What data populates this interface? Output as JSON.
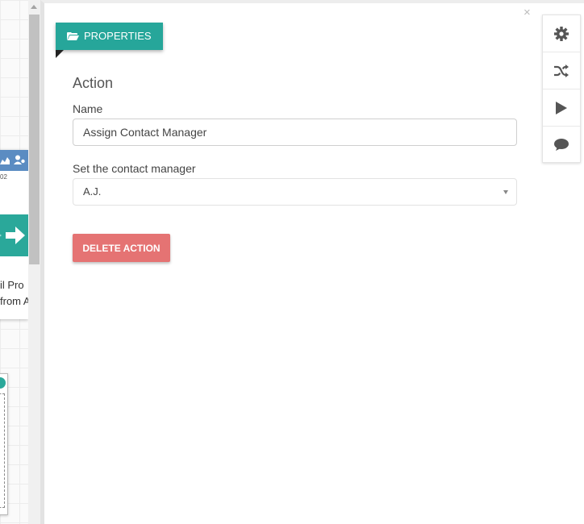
{
  "canvas": {
    "node_line1": "il Pro",
    "node_line2": "from A",
    "node_small": "02"
  },
  "panel": {
    "close": "×",
    "tag_label": "PROPERTIES",
    "section_title": "Action",
    "name_label": "Name",
    "name_value": "Assign Contact Manager",
    "manager_label": "Set the contact manager",
    "manager_value": "A.J.",
    "delete_label": "DELETE ACTION"
  },
  "toolbar": {
    "icons": [
      "gear-icon",
      "shuffle-icon",
      "play-icon",
      "comment-icon"
    ]
  },
  "colors": {
    "accent": "#26a69a",
    "danger": "#e57373",
    "icon": "#555555"
  }
}
